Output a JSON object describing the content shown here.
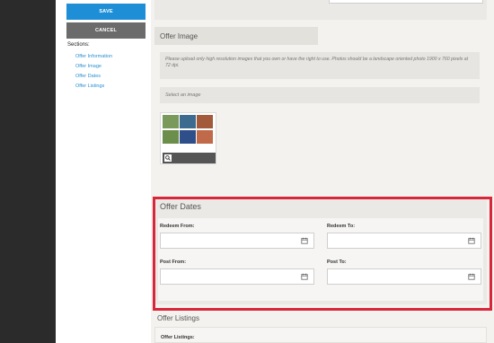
{
  "sidebar": {
    "save_label": "SAVE",
    "cancel_label": "CANCEL",
    "sections_label": "Sections:",
    "links": [
      "Offer Information",
      "Offer Image",
      "Offer Dates",
      "Offer Listings"
    ]
  },
  "offer_image": {
    "title": "Offer Image",
    "info_text": "Please upload only high resolution images that you own or have the right to use. Photos should be a landscape oriented photo 1900 x 760 pixels at 72 dpi.",
    "select_label": "Select an image"
  },
  "offer_dates": {
    "title": "Offer Dates",
    "redeem_from_label": "Redeem From:",
    "redeem_to_label": "Redeem To:",
    "post_from_label": "Post From:",
    "post_to_label": "Post To:",
    "redeem_from_value": "",
    "redeem_to_value": "",
    "post_from_value": "",
    "post_to_value": ""
  },
  "offer_listings": {
    "title": "Offer Listings",
    "field_label": "Offer Listings:"
  },
  "colors": {
    "save_button": "#1e8fd6",
    "cancel_button": "#6b6b6b",
    "link": "#2a8fd0",
    "highlight": "#d8263a",
    "dark_rail": "#2b2b2b"
  },
  "icons": [
    "calendar-icon",
    "zoom-icon"
  ]
}
